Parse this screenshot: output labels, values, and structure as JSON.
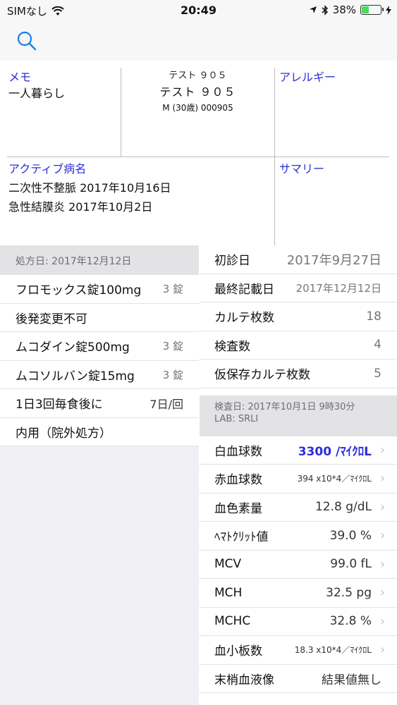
{
  "status": {
    "carrier": "SIMなし",
    "time": "20:49",
    "battery": "38%",
    "battery_level": 0.38
  },
  "patient": {
    "kana": "テスト ９０５",
    "name": "テスト ９０５",
    "meta": "M (30歳) 000905"
  },
  "memo": {
    "label": "メモ",
    "text": "一人暮らし"
  },
  "allergy": {
    "label": "アレルギー"
  },
  "active": {
    "label": "アクティブ病名",
    "items": [
      "二次性不整脈 2017年10月16日",
      "急性結膜炎 2017年10月2日"
    ]
  },
  "summary": {
    "label": "サマリー"
  },
  "prescription": {
    "header": "処方日: 2017年12月12日",
    "items": [
      {
        "name": "フロモックス錠100mg",
        "qty": "3 錠"
      },
      {
        "name": "後発変更不可",
        "qty": ""
      },
      {
        "name": "ムコダイン錠500mg",
        "qty": "3 錠"
      },
      {
        "name": "ムコソルバン錠15mg",
        "qty": "3 錠"
      },
      {
        "name": "1日3回毎食後に",
        "qty": "7日/回"
      },
      {
        "name": "内用（院外処方）",
        "qty": ""
      }
    ]
  },
  "info": [
    {
      "label": "初診日",
      "value": "2017年9月27日"
    },
    {
      "label": "最終記載日",
      "value": "2017年12月12日"
    },
    {
      "label": "カルテ枚数",
      "value": "18"
    },
    {
      "label": "検査数",
      "value": "4"
    },
    {
      "label": "仮保存カルテ枚数",
      "value": "5"
    }
  ],
  "lab": {
    "header_line1": "検査日: 2017年10月1日 9時30分",
    "header_line2": "LAB: SRLI",
    "items": [
      {
        "name": "白血球数",
        "value": "3300 /ﾏｲｸﾛL"
      },
      {
        "name": "赤血球数",
        "value": "394 x10*4／ﾏｲｸﾛL"
      },
      {
        "name": "血色素量",
        "value": "12.8 g/dL"
      },
      {
        "name": "ﾍﾏﾄｸﾘｯﾄ値",
        "value": "39.0 %"
      },
      {
        "name": "MCV",
        "value": "99.0 fL"
      },
      {
        "name": "MCH",
        "value": "32.5 pg"
      },
      {
        "name": "MCHC",
        "value": "32.8 %"
      },
      {
        "name": "血小板数",
        "value": "18.3 x10*4／ﾏｲｸﾛL"
      },
      {
        "name": "末梢血液像",
        "value": "結果値無し"
      }
    ]
  },
  "colors": {
    "accent": "#2b2fd6",
    "battery": "#4cd964",
    "section_bg": "#e3e3e6"
  }
}
